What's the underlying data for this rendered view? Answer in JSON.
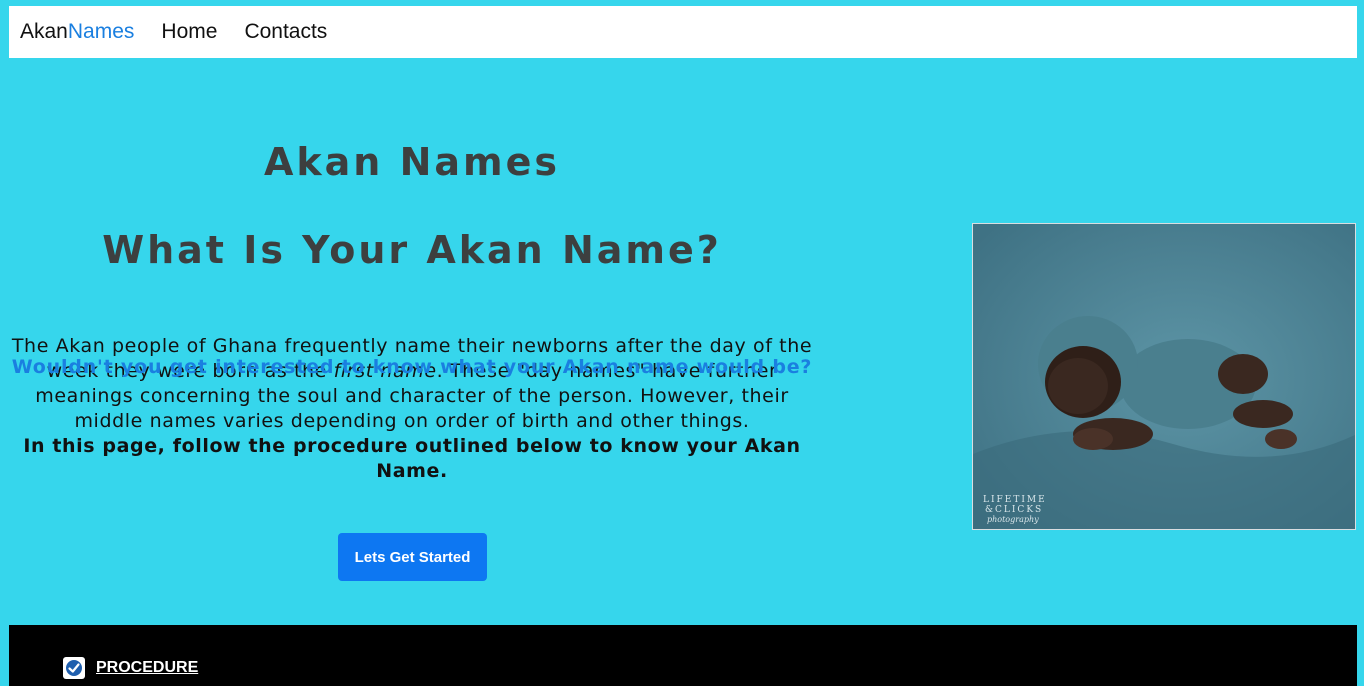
{
  "navbar": {
    "brand_prefix": "Akan",
    "brand_suffix": "Names",
    "links": [
      "Home",
      "Contacts"
    ]
  },
  "hero": {
    "title": "Akan Names",
    "subtitle": "What Is Your Akan Name?",
    "intro_part1": "The Akan people of Ghana frequently name their newborns after the day of the week they were born as the ",
    "intro_emphasis": "first name",
    "intro_part2": ". These \"day names\" have further meanings concerning the soul and character of the person. However, their middle names varies depending on order of birth and other things.",
    "intro_bold": "In this page, follow the procedure outlined below to know your Akan Name.",
    "question": "Wouldn't you get interested to know what your Akan name would be?",
    "cta_label": "Lets Get Started"
  },
  "photo": {
    "watermark_line1": "LIFETIME",
    "watermark_line2": "&CLICKS",
    "watermark_line3": "photography"
  },
  "footer": {
    "procedure_label": "PROCEDURE"
  },
  "colors": {
    "background": "#36d6ec",
    "accent": "#1a7fe0",
    "button": "#0d77f2"
  }
}
